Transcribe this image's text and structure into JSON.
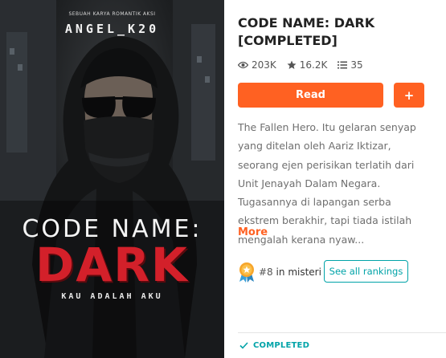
{
  "cover": {
    "tagline": "SEBUAH KARYA ROMANTIK AKSI",
    "author": "ANGEL_K20",
    "title_line1": "CODE NAME:",
    "title_line2": "DARK",
    "subtitle": "KAU ADALAH AKU"
  },
  "story": {
    "title": "CODE NAME: DARK [COMPLETED]",
    "stats": {
      "reads": "203K",
      "votes": "16.2K",
      "parts": "35"
    },
    "read_label": "Read",
    "add_label": "+",
    "description": "The Fallen Hero. Itu gelaran senyap yang ditelan oleh Aariz Iktizar, seorang ejen perisikan terlatih dari Unit Jenayah Dalam Negara. Tugasannya di lapangan serba ekstrem berakhir, tapi tiada istilah mengalah kerana nyaw...",
    "more_label": "More",
    "ranking": {
      "rank": "#8",
      "in_word": "in",
      "category": "misteri"
    },
    "see_rankings_label": "See all rankings",
    "status_label": "COMPLETED"
  },
  "colors": {
    "accent": "#ff6122",
    "teal": "#00a3a8",
    "title_red": "#d3202a"
  },
  "icons": [
    "eye-icon",
    "star-icon",
    "list-icon",
    "ranking-medal-icon",
    "check-icon"
  ]
}
